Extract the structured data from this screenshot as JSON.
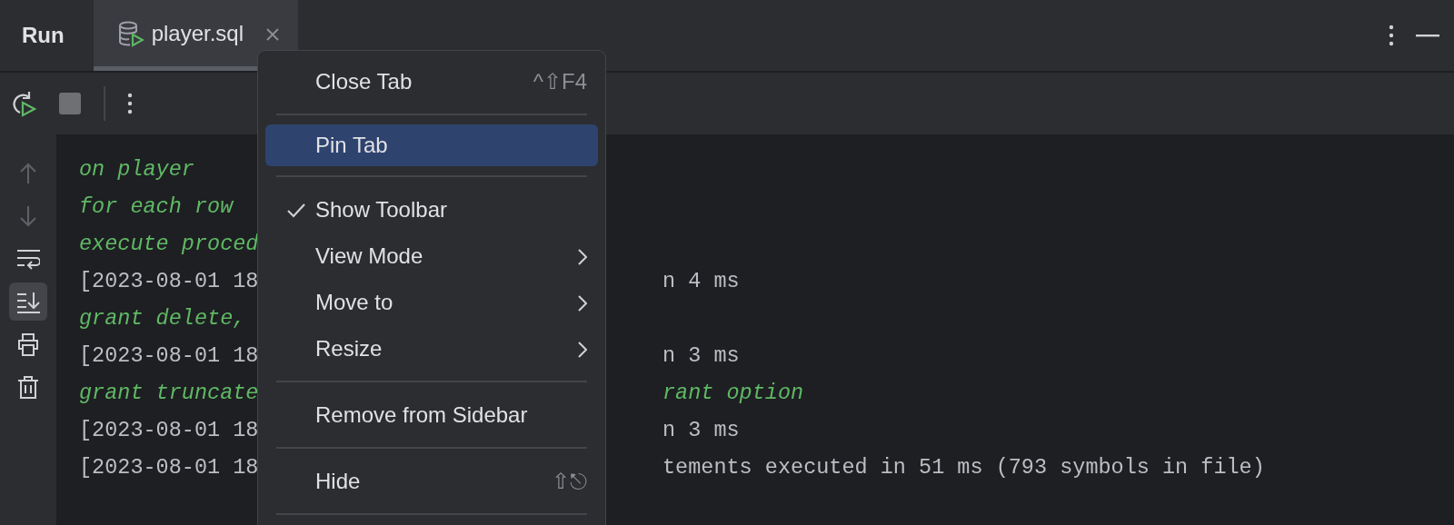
{
  "panel": {
    "title": "Run"
  },
  "tabs": [
    {
      "label": "player.sql",
      "selected": true
    }
  ],
  "sidebar_tools": [
    {
      "kind": "up",
      "selected": false,
      "disabled": true
    },
    {
      "kind": "down",
      "selected": false,
      "disabled": true
    },
    {
      "kind": "wrap",
      "selected": false,
      "disabled": false
    },
    {
      "kind": "scroll-end",
      "selected": true,
      "disabled": false
    },
    {
      "kind": "print",
      "selected": false,
      "disabled": false
    },
    {
      "kind": "trash",
      "selected": false,
      "disabled": false
    }
  ],
  "console_lines": [
    {
      "kind": "sql",
      "left": "on player"
    },
    {
      "kind": "sql",
      "left": "for each row"
    },
    {
      "kind": "sql",
      "left": "execute proced"
    },
    {
      "kind": "log",
      "left": "[2023-08-01 18",
      "right": "n 4 ms"
    },
    {
      "kind": "sql",
      "left": "grant delete,"
    },
    {
      "kind": "log",
      "left": "[2023-08-01 18",
      "right": "n 3 ms"
    },
    {
      "kind": "sql",
      "left": "grant truncate",
      "right": "rant option"
    },
    {
      "kind": "log",
      "left": "[2023-08-01 18",
      "right": "n 3 ms"
    },
    {
      "kind": "log",
      "left": "[2023-08-01 18",
      "right": "tements executed in 51 ms (793 symbols in file)"
    }
  ],
  "context_menu": [
    {
      "kind": "item",
      "label": "Close Tab",
      "shortcut": "^⇧F4",
      "checked": false,
      "submenu": false,
      "selected": false
    },
    {
      "kind": "separator"
    },
    {
      "kind": "item",
      "label": "Pin Tab",
      "checked": false,
      "submenu": false,
      "selected": true
    },
    {
      "kind": "separator"
    },
    {
      "kind": "item",
      "label": "Show Toolbar",
      "checked": true,
      "submenu": false,
      "selected": false
    },
    {
      "kind": "item",
      "label": "View Mode",
      "checked": false,
      "submenu": true,
      "selected": false
    },
    {
      "kind": "item",
      "label": "Move to",
      "checked": false,
      "submenu": true,
      "selected": false
    },
    {
      "kind": "item",
      "label": "Resize",
      "checked": false,
      "submenu": true,
      "selected": false
    },
    {
      "kind": "separator"
    },
    {
      "kind": "item",
      "label": "Remove from Sidebar",
      "checked": false,
      "submenu": false,
      "selected": false
    },
    {
      "kind": "separator"
    },
    {
      "kind": "item",
      "label": "Hide",
      "shortcut": "⇧⎋",
      "checked": false,
      "submenu": false,
      "selected": false
    },
    {
      "kind": "separator"
    }
  ]
}
